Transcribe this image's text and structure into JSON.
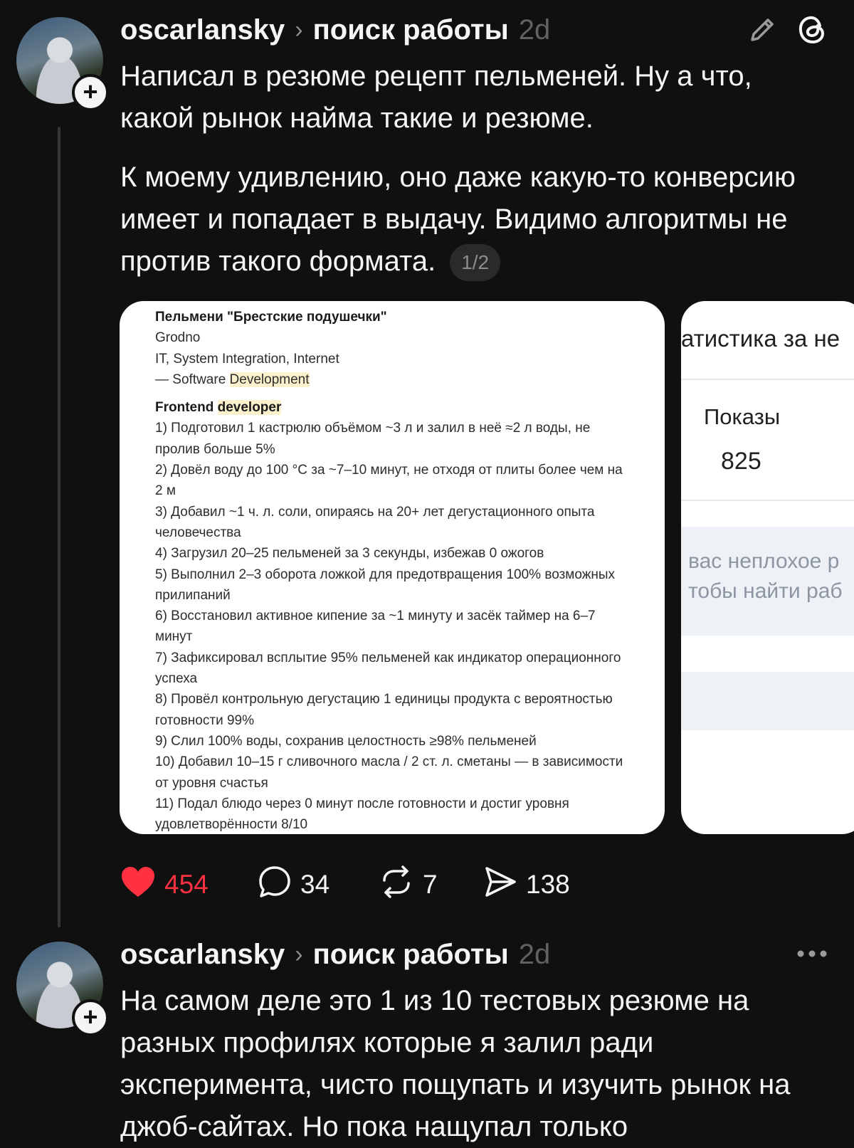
{
  "post1": {
    "username": "oscarlansky",
    "topic": "поиск работы",
    "time": "2d",
    "text_p1": "Написал в резюме рецепт пельменей. Ну а что, какой рынок найма такие и резюме.",
    "text_p2": "К моему удивлению, оно даже какую-то конверсию имеет и попадает в выдачу. Видимо алгоритмы не против такого формата.",
    "carousel_counter": "1/2",
    "icons": {
      "edit": "pencil-icon",
      "app": "threads-logo-icon"
    },
    "resume": {
      "title": "Пельмени \"Брестские подушечки\"",
      "city": "Grodno",
      "industry": "IT, System Integration, Internet",
      "spec_prefix": "— Software ",
      "spec_hl": "Development",
      "role_prefix": "Frontend ",
      "role_hl": "developer",
      "steps": [
        "1) Подготовил 1 кастрюлю объёмом ~3 л и залил в неё ≈2 л воды, не пролив больше 5%",
        "2) Довёл воду до 100 °C за ~7–10 минут, не отходя от плиты более чем на 2 м",
        "3) Добавил ~1 ч. л. соли, опираясь на 20+ лет дегустационного опыта человечества",
        "4) Загрузил 20–25 пельменей за 3 секунды, избежав 0 ожогов",
        "5) Выполнил 2–3 оборота ложкой для предотвращения 100% возможных прилипаний",
        "6) Восстановил активное кипение за ~1 минуту и засёк таймер на 6–7 минут",
        "7) Зафиксировал всплытие 95% пельменей как индикатор операционного успеха",
        "8) Провёл контрольную дегустацию 1 единицы продукта с вероятностью готовности 99%",
        "9) Слил 100% воды, сохранив целостность ≥98% пельменей",
        "10) Добавил 10–15 г сливочного масла / 2 ст. л. сметаны — в зависимости от уровня счастья",
        "11) Подал блюдо через 0 минут после готовности и достиг уровня удовлетворённости 8/10"
      ]
    },
    "stats": {
      "heading": "атистика за не",
      "label": "Показы",
      "value": "825",
      "note_line1": "вас неплохое р",
      "note_line2": "тобы найти раб"
    },
    "actions": {
      "likes": "454",
      "comments": "34",
      "reposts": "7",
      "shares": "138"
    },
    "colors": {
      "like": "#ff3040",
      "background": "#101010"
    }
  },
  "post2": {
    "username": "oscarlansky",
    "topic": "поиск работы",
    "time": "2d",
    "more_icon": "more-dots-icon",
    "text": "На самом деле это 1 из 10 тестовых резюме на разных профилях которые я залил ради эксперимента, чисто пощупать и изучить рынок на джоб-сайтах. Но пока нащупал только"
  }
}
